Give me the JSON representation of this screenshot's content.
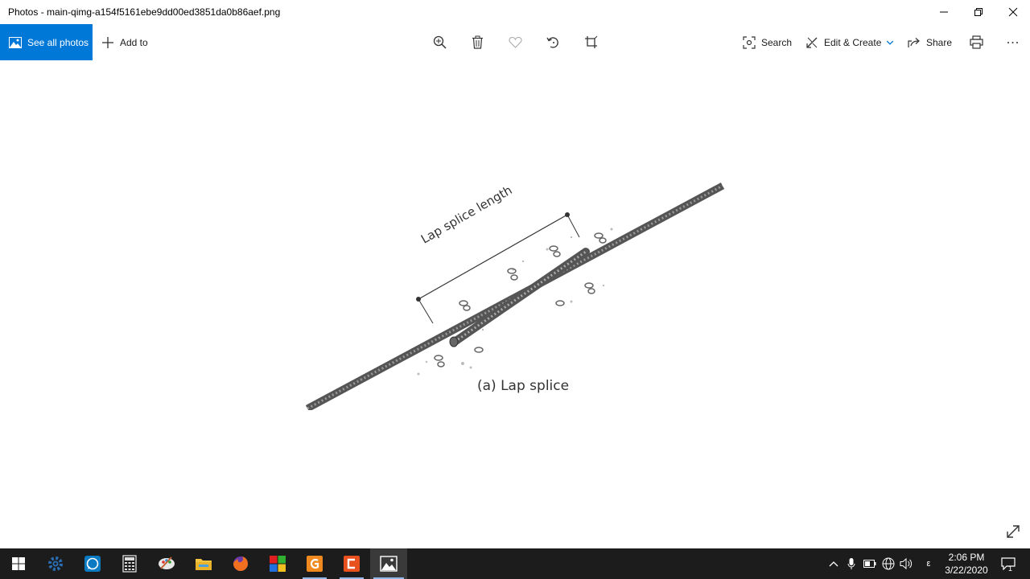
{
  "window": {
    "title": "Photos - main-qimg-a154f5161ebe9dd00ed3851da0b86aef.png",
    "minimize_icon": "minimize-icon",
    "restore_icon": "restore-icon",
    "close_icon": "close-icon"
  },
  "toolbar": {
    "see_all_label": "See all photos",
    "add_to_label": "Add to",
    "search_label": "Search",
    "edit_create_label": "Edit & Create",
    "share_label": "Share",
    "accent": "#0078d7",
    "icons": [
      "zoom-icon",
      "delete-icon",
      "favorite-icon",
      "rotate-icon",
      "crop-icon",
      "print-icon",
      "more-icon"
    ]
  },
  "image": {
    "annotation": "Lap splice length",
    "caption": "(a) Lap splice"
  },
  "taskbar": {
    "apps": [
      "windows-start",
      "settings",
      "whatsapp",
      "calculator",
      "paint",
      "file-explorer",
      "firefox",
      "store",
      "app-g",
      "app-c",
      "photos"
    ],
    "tray_letter": "ε",
    "time": "2:06 PM",
    "date": "3/22/2020",
    "notification_count": "1"
  }
}
